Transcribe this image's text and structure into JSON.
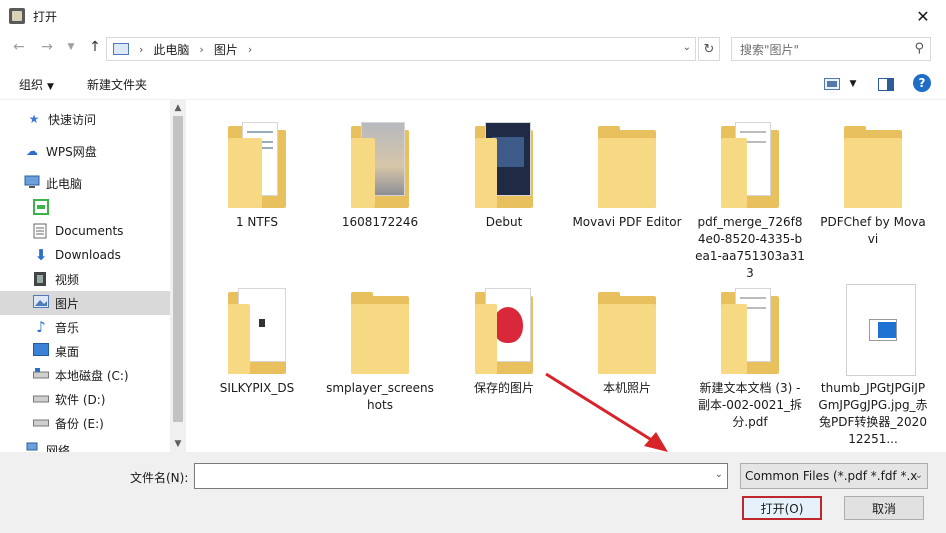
{
  "window": {
    "title": "打开"
  },
  "address": {
    "crumbs": [
      "此电脑",
      "图片"
    ],
    "search_placeholder": "搜索\"图片\""
  },
  "toolbar": {
    "organize": "组织",
    "new_folder": "新建文件夹"
  },
  "sidebar": {
    "items": [
      {
        "label": "快速访问",
        "icon": "star-icon"
      },
      {
        "label": "WPS网盘",
        "icon": "cloud-icon"
      },
      {
        "label": "此电脑",
        "icon": "computer-icon"
      },
      {
        "label": "",
        "icon": "app-green-icon"
      },
      {
        "label": "Documents",
        "icon": "document-icon"
      },
      {
        "label": "Downloads",
        "icon": "download-icon"
      },
      {
        "label": "视频",
        "icon": "video-icon"
      },
      {
        "label": "图片",
        "icon": "picture-icon"
      },
      {
        "label": "音乐",
        "icon": "music-icon"
      },
      {
        "label": "桌面",
        "icon": "desktop-icon"
      },
      {
        "label": "本地磁盘 (C:)",
        "icon": "drive-icon"
      },
      {
        "label": "软件 (D:)",
        "icon": "drive-icon"
      },
      {
        "label": "备份 (E:)",
        "icon": "drive-icon"
      },
      {
        "label": "网络",
        "icon": "network-icon"
      }
    ],
    "selected_index": 7
  },
  "files": [
    {
      "name": "1 NTFS",
      "kind": "folder-doc"
    },
    {
      "name": "1608172246",
      "kind": "folder-photo"
    },
    {
      "name": "Debut",
      "kind": "folder-screen"
    },
    {
      "name": "Movavi PDF Editor",
      "kind": "folder"
    },
    {
      "name": "pdf_merge_726f84e0-8520-4335-bea1-aa751303a313",
      "kind": "folder-doc"
    },
    {
      "name": "PDFChef by Movavi",
      "kind": "folder"
    },
    {
      "name": "SILKYPIX_DS",
      "kind": "folder-doc"
    },
    {
      "name": "smplayer_screenshots",
      "kind": "folder"
    },
    {
      "name": "保存的图片",
      "kind": "folder-strawberry"
    },
    {
      "name": "本机照片",
      "kind": "folder"
    },
    {
      "name": "新建文本文档 (3) - 副本-002-0021_拆分.pdf",
      "kind": "folder-doc"
    },
    {
      "name": "thumb_JPGtJPGiJPGmJPGgJPG.jpg_赤兔PDF转换器_202012251...",
      "kind": "image"
    }
  ],
  "bottom": {
    "filename_label": "文件名(N):",
    "filename_value": "",
    "filter": "Common Files (*.pdf *.fdf *.x",
    "open_label": "打开(O)",
    "cancel_label": "取消"
  },
  "colors": {
    "accent": "#1e6ec8",
    "highlight_border": "#c0272d",
    "folder": "#f7d883"
  }
}
